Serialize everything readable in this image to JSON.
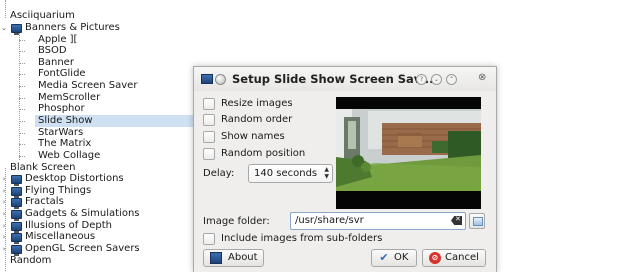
{
  "tree": {
    "items": [
      {
        "label": "Asciiquarium"
      },
      {
        "label": "Banners & Pictures"
      },
      {
        "label": "Apple ][",
        "parent": "Banners & Pictures"
      },
      {
        "label": "BSOD",
        "parent": "Banners & Pictures"
      },
      {
        "label": "Banner",
        "parent": "Banners & Pictures"
      },
      {
        "label": "FontGlide",
        "parent": "Banners & Pictures"
      },
      {
        "label": "Media Screen Saver",
        "parent": "Banners & Pictures"
      },
      {
        "label": "MemScroller",
        "parent": "Banners & Pictures"
      },
      {
        "label": "Phosphor",
        "parent": "Banners & Pictures"
      },
      {
        "label": "Slide Show",
        "parent": "Banners & Pictures",
        "selected": true
      },
      {
        "label": "StarWars",
        "parent": "Banners & Pictures"
      },
      {
        "label": "The Matrix",
        "parent": "Banners & Pictures"
      },
      {
        "label": "Web Collage",
        "parent": "Banners & Pictures"
      },
      {
        "label": "Blank Screen"
      },
      {
        "label": "Desktop Distortions"
      },
      {
        "label": "Flying Things"
      },
      {
        "label": "Fractals"
      },
      {
        "label": "Gadgets & Simulations"
      },
      {
        "label": "Illusions of Depth"
      },
      {
        "label": "Miscellaneous"
      },
      {
        "label": "OpenGL Screen Savers"
      },
      {
        "label": "Random"
      }
    ]
  },
  "dialog": {
    "title": "Setup Slide Show Screen Sav...",
    "options": [
      {
        "label": "Resize images",
        "checked": false
      },
      {
        "label": "Random order",
        "checked": false
      },
      {
        "label": "Show names",
        "checked": false
      },
      {
        "label": "Random position",
        "checked": false
      }
    ],
    "delay": {
      "label": "Delay:",
      "value": "140 seconds"
    },
    "image_folder": {
      "label": "Image folder:",
      "value": "/usr/share/svr"
    },
    "include_subfolders": {
      "label": "Include images from sub-folders",
      "checked": false
    },
    "buttons": {
      "about": "About",
      "ok": "OK",
      "cancel": "Cancel"
    }
  },
  "colors": {
    "selection": "#cfe0f3",
    "cancel_icon": "#d9312b",
    "ok_icon": "#2c6fc0",
    "folder_icon": "#2a5a99"
  }
}
